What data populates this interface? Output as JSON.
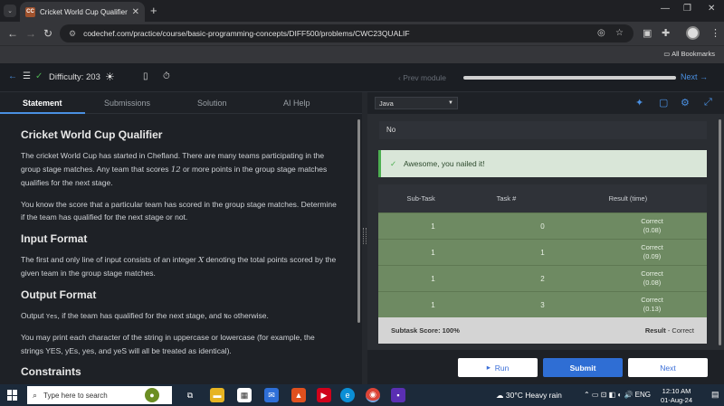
{
  "browser": {
    "tab_title": "Cricket World Cup Qualifier Pra",
    "tab_favicon": "CC",
    "url": "codechef.com/practice/course/basic-programming-concepts/DIFF500/problems/CWC23QUALIF",
    "all_bookmarks": "All Bookmarks"
  },
  "header": {
    "difficulty_label": "Difficulty:",
    "difficulty_value": "203",
    "prev_module": "Prev module",
    "next_module": "Next",
    "module_progress": 1.0
  },
  "left_tabs": [
    "Statement",
    "Submissions",
    "Solution",
    "AI Help"
  ],
  "statement": {
    "title": "Cricket World Cup Qualifier",
    "p1_a": "The cricket World Cup has started in Chefland. There are many teams participating in the group stage matches. Any team that scores ",
    "p1_num": "12",
    "p1_b": " or more points in the group stage matches qualifies for the next stage.",
    "p2": "You know the score that a particular team has scored in the group stage matches. Determine if the team has qualified for the next stage or not.",
    "input_heading": "Input Format",
    "input_a": "The first and only line of input consists of an integer ",
    "input_var": "X",
    "input_b": " denoting the total points scored by the given team in the group stage matches.",
    "output_heading": "Output Format",
    "output_a": "Output ",
    "output_yes": "Yes",
    "output_b": ", if the team has qualified for the next stage, and ",
    "output_no": "No",
    "output_c": " otherwise.",
    "output_p2": "You may print each character of the string in uppercase or lowercase (for example, the strings YES, yEs, yes, and yeS will all be treated as identical).",
    "constraints_heading": "Constraints"
  },
  "editor": {
    "language": "Java",
    "output_text": "No",
    "success_message": "Awesome, you nailed it!",
    "table_headers": [
      "Sub-Task",
      "Task #",
      "Result (time)"
    ],
    "rows": [
      {
        "subtask": "1",
        "task": "0",
        "result": "Correct",
        "time": "(0.08)"
      },
      {
        "subtask": "1",
        "task": "1",
        "result": "Correct",
        "time": "(0.09)"
      },
      {
        "subtask": "1",
        "task": "2",
        "result": "Correct",
        "time": "(0.08)"
      },
      {
        "subtask": "1",
        "task": "3",
        "result": "Correct",
        "time": "(0.13)"
      }
    ],
    "subtask_score": "Subtask Score: 100%",
    "result_label": "Result",
    "result_value": "- Correct",
    "run_label": "Run",
    "submit_label": "Submit",
    "next_label": "Next"
  },
  "taskbar": {
    "search_placeholder": "Type here to search",
    "weather": "30°C  Heavy rain",
    "lang": "ENG",
    "time": "12:10 AM",
    "date": "01-Aug-24"
  }
}
